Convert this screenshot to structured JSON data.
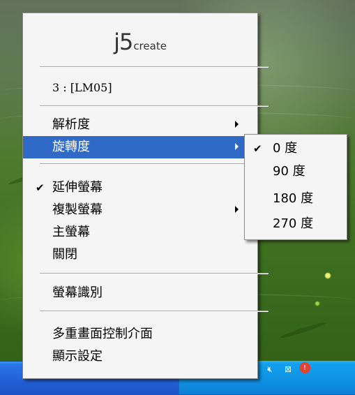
{
  "menu": {
    "logo": {
      "brand": "j5",
      "suffix": "create"
    },
    "monitor_label": "3 : [LM05]",
    "items": [
      {
        "label": "解析度",
        "submenu": true,
        "checked": false,
        "selected": false
      },
      {
        "label": "旋轉度",
        "submenu": true,
        "checked": false,
        "selected": true
      },
      {
        "label": "延伸螢幕",
        "submenu": false,
        "checked": true,
        "selected": false
      },
      {
        "label": "複製螢幕",
        "submenu": true,
        "checked": false,
        "selected": false
      },
      {
        "label": "主螢幕",
        "submenu": false,
        "checked": false,
        "selected": false
      },
      {
        "label": "關閉",
        "submenu": false,
        "checked": false,
        "selected": false
      },
      {
        "label": "螢幕識別",
        "submenu": false,
        "checked": false,
        "selected": false
      },
      {
        "label": "多重畫面控制介面",
        "submenu": false,
        "checked": false,
        "selected": false
      },
      {
        "label": "顯示設定",
        "submenu": false,
        "checked": false,
        "selected": false
      }
    ],
    "check_mark": "✔"
  },
  "rotation_submenu": {
    "items": [
      {
        "label": "0 度",
        "checked": true
      },
      {
        "label": "90 度",
        "checked": false
      },
      {
        "label": "180 度",
        "checked": false
      },
      {
        "label": "270 度",
        "checked": false
      }
    ]
  },
  "tray": {
    "icons": [
      "keyboard-icon",
      "chevron-left-icon",
      "display-icon",
      "security-shield-icon",
      "speaker-muted-icon",
      "network-disconnected-icon",
      "alert-icon"
    ]
  },
  "colors": {
    "highlight": "#3169c6",
    "menu_bg": "#f5f5f5",
    "taskbar": "#2361d8",
    "tray": "#0f90e2"
  }
}
